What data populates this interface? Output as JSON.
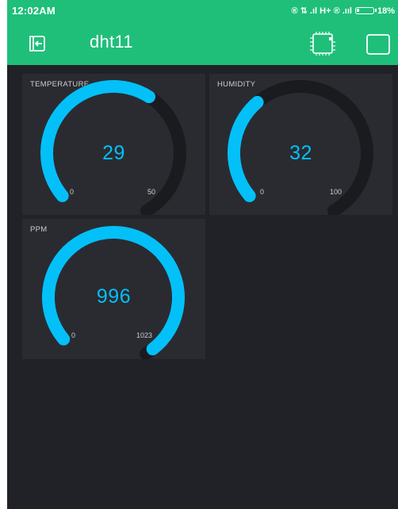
{
  "status_bar": {
    "time": "12:02AM",
    "indicators": "® ⇅ .ıl H+ ® .ııl",
    "battery": "18%"
  },
  "app_bar": {
    "title": "dht11",
    "icons": [
      "exit-icon",
      "device-chip-icon",
      "square-icon"
    ]
  },
  "colors": {
    "app_bar": "#1fbf7a",
    "background": "#212227",
    "widget": "#2a2b31",
    "gauge_accent": "#04c0f8",
    "gauge_track": "#1a1b1f"
  },
  "gauges": [
    {
      "id": "temperature",
      "label": "TEMPERATURE",
      "value": "29",
      "min": "0",
      "max": "50",
      "fraction": 0.58
    },
    {
      "id": "humidity",
      "label": "HUMIDITY",
      "value": "32",
      "min": "0",
      "max": "100",
      "fraction": 0.32
    },
    {
      "id": "ppm",
      "label": "PPM",
      "value": "996",
      "min": "0",
      "max": "1023",
      "fraction": 0.974
    }
  ]
}
